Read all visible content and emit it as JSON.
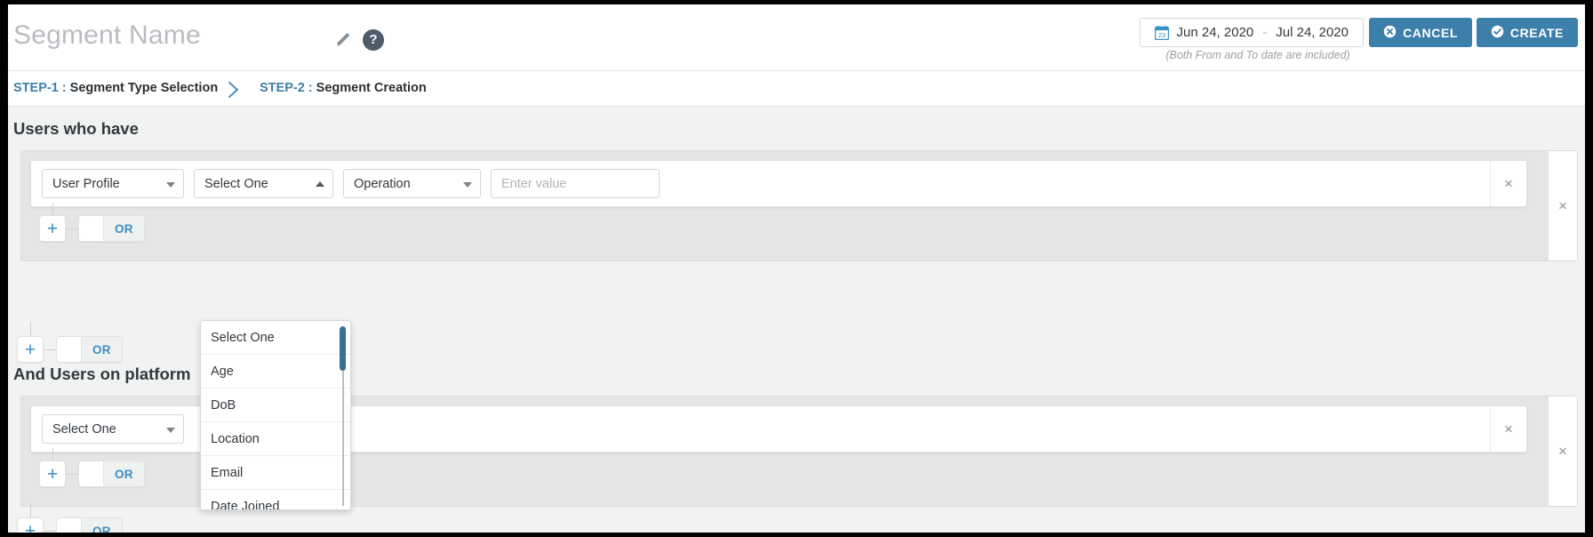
{
  "header": {
    "segment_name_placeholder": "Segment Name",
    "edit_icon": "pencil-icon",
    "help_icon": "question-mark-icon",
    "date_range": {
      "icon": "calendar-icon",
      "from": "Jun 24, 2020",
      "separator": "-",
      "to": "Jul 24, 2020",
      "note": "(Both From and To date are included)"
    },
    "cancel_label": "CANCEL",
    "create_label": "CREATE",
    "accent_color": "#3d7fab"
  },
  "steps": [
    {
      "num": "STEP-1 :",
      "label": " Segment Type Selection"
    },
    {
      "num": "STEP-2 :",
      "label": " Segment Creation"
    }
  ],
  "sections": [
    {
      "heading": "Users who have",
      "condition": {
        "attribute_group": "User Profile",
        "attribute": "Select One",
        "operation": "Operation",
        "value": "",
        "value_placeholder": "Enter value"
      },
      "or_label": "OR",
      "plus_label": "+"
    },
    {
      "heading": "And Users on platform",
      "condition": {
        "attribute_group": "Select One"
      },
      "or_label": "OR",
      "plus_label": "+"
    }
  ],
  "dropdown": {
    "open": true,
    "options": [
      "Select One",
      "Age",
      "DoB",
      "Location",
      "Email",
      "Date Joined"
    ]
  },
  "icons": {
    "close": "×"
  }
}
